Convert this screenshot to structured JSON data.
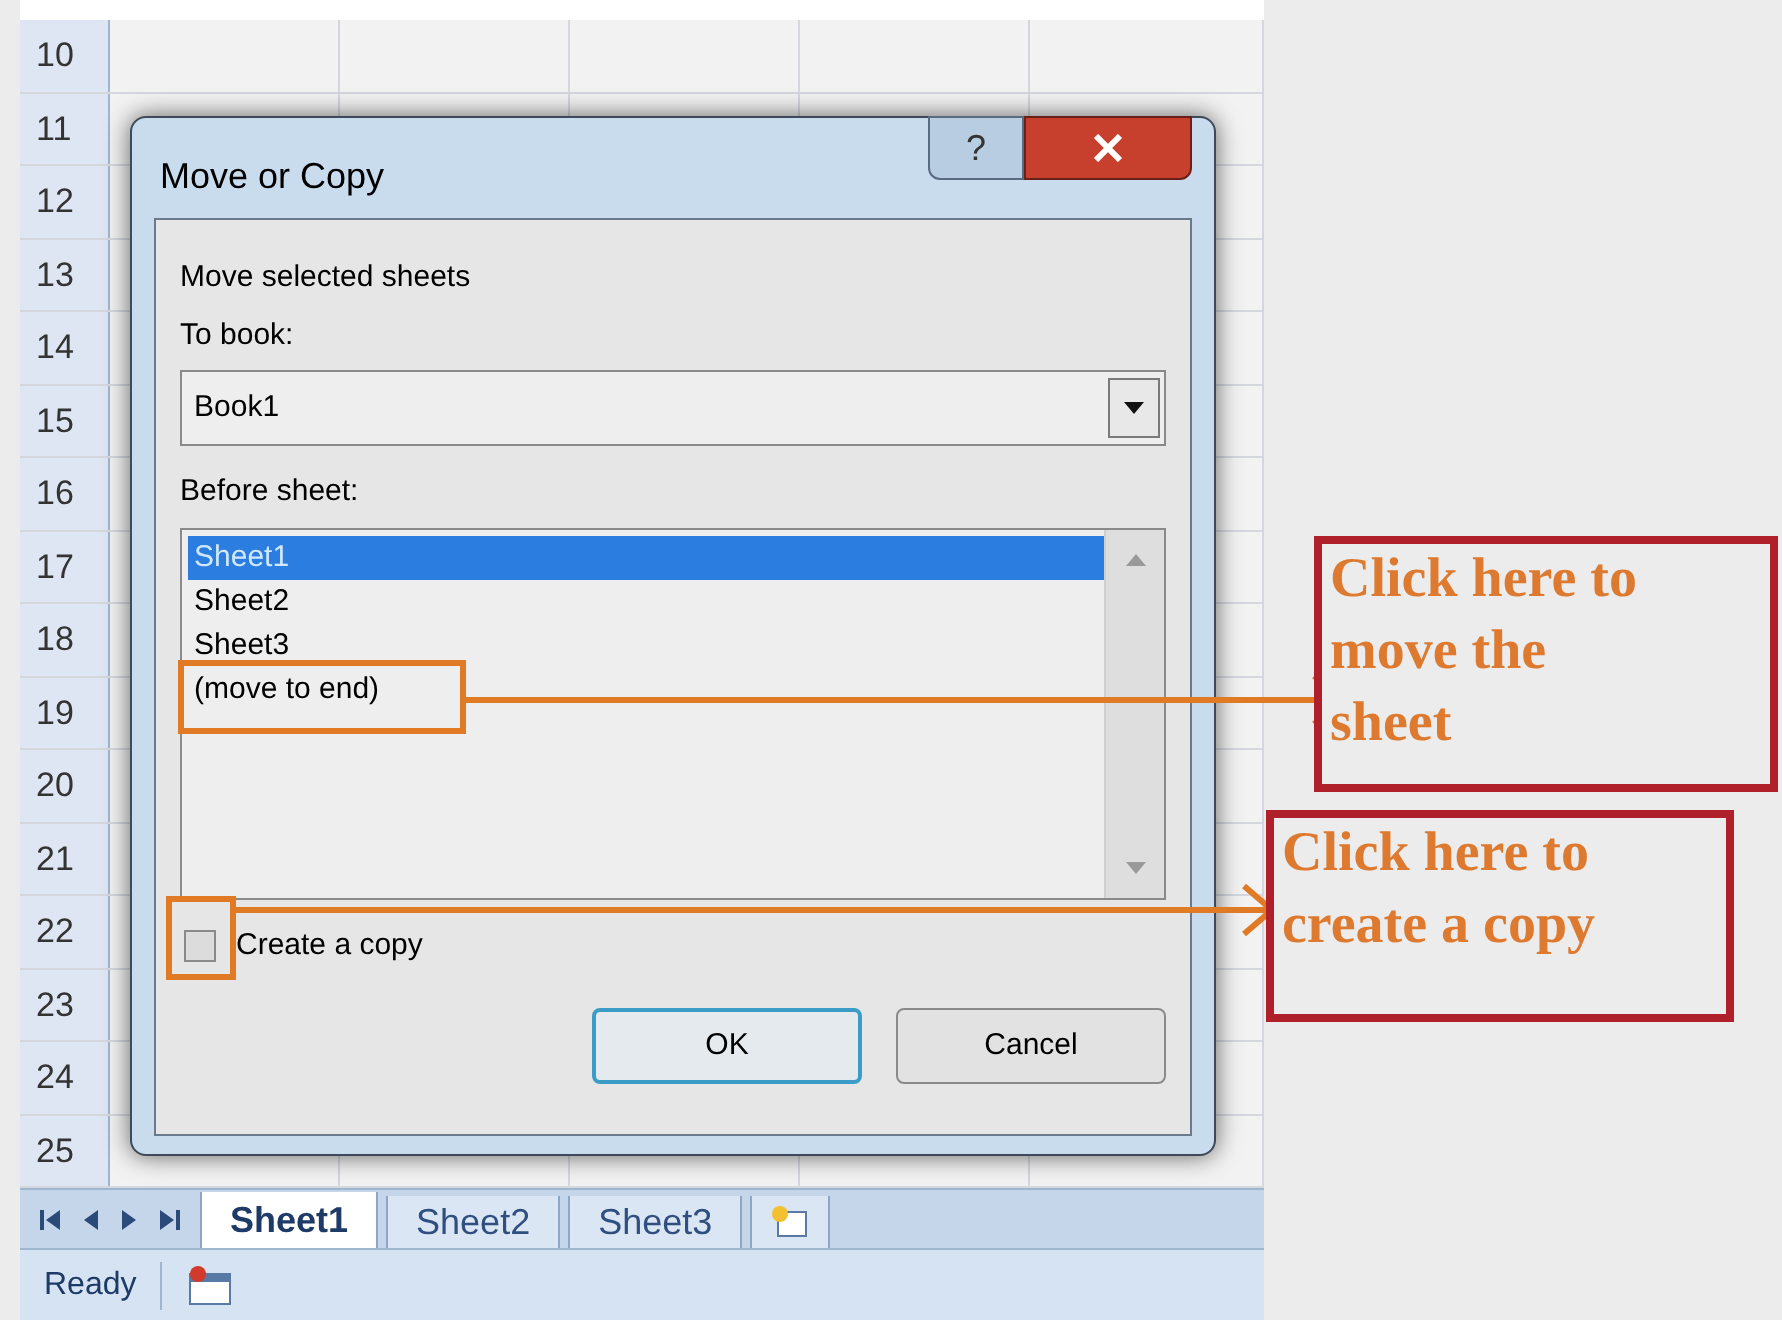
{
  "row_numbers": [
    "10",
    "11",
    "12",
    "13",
    "14",
    "15",
    "16",
    "17",
    "18",
    "19",
    "20",
    "21",
    "22",
    "23",
    "24",
    "25"
  ],
  "dialog": {
    "title": "Move or Copy",
    "help_button": "?",
    "heading": "Move selected sheets",
    "to_book_label": "To book:",
    "to_book_value": "Book1",
    "before_sheet_label": "Before sheet:",
    "sheets": [
      {
        "label": "Sheet1",
        "selected": true
      },
      {
        "label": "Sheet2",
        "selected": false
      },
      {
        "label": "Sheet3",
        "selected": false
      },
      {
        "label": "(move to end)",
        "selected": false
      }
    ],
    "create_copy": {
      "label": "Create a copy",
      "checked": false
    },
    "buttons": [
      {
        "label": "OK",
        "default": true
      },
      {
        "label": "Cancel",
        "default": false
      }
    ]
  },
  "sheet_tabs": [
    {
      "label": "Sheet1",
      "selected": true
    },
    {
      "label": "Sheet2",
      "selected": false
    },
    {
      "label": "Sheet3",
      "selected": false
    }
  ],
  "status_bar": {
    "text": "Ready"
  },
  "annotations": [
    {
      "lines": [
        "Click here to",
        "move the",
        "sheet"
      ]
    },
    {
      "lines": [
        "Click here to",
        "create a copy"
      ]
    }
  ]
}
